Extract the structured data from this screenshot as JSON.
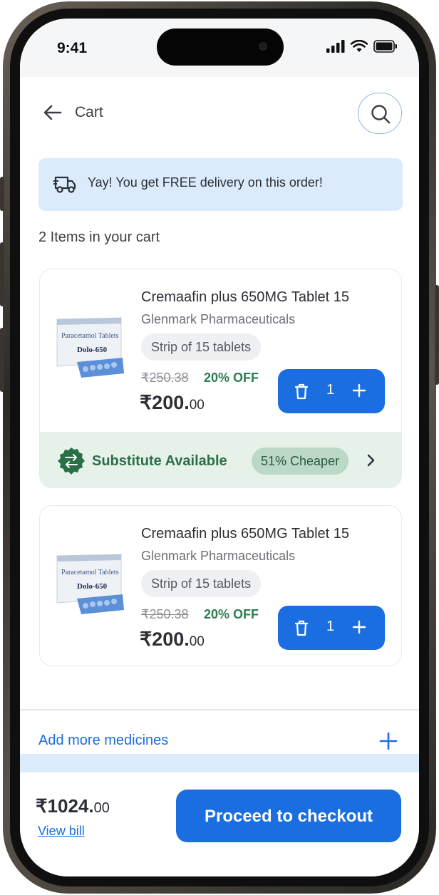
{
  "status_bar": {
    "time": "9:41"
  },
  "header": {
    "title": "Cart"
  },
  "delivery_banner": {
    "text": "Yay! You get FREE delivery on this order!"
  },
  "cart": {
    "count_label": "2 Items in your cart",
    "items": [
      {
        "name": "Cremaafin plus 650MG Tablet 15",
        "brand": "Glenmark Pharmaceuticals",
        "pack": "Strip of 15 tablets",
        "mrp": "₹250.38",
        "discount": "20% OFF",
        "price_main": "₹200.",
        "price_paise": "00",
        "quantity": "1",
        "image_label_top": "Paracetamol Tablets",
        "image_label_brand": "Dolo-650"
      },
      {
        "name": "Cremaafin plus 650MG Tablet 15",
        "brand": "Glenmark Pharmaceuticals",
        "pack": "Strip of 15 tablets",
        "mrp": "₹250.38",
        "discount": "20% OFF",
        "price_main": "₹200.",
        "price_paise": "00",
        "quantity": "1",
        "image_label_top": "Paracetamol Tablets",
        "image_label_brand": "Dolo-650"
      }
    ],
    "substitute": {
      "label": "Substitute Available",
      "badge": "51% Cheaper"
    }
  },
  "add_more": {
    "label": "Add more medicines"
  },
  "footer": {
    "total_main": "₹1024.",
    "total_paise": "00",
    "view_bill": "View bill",
    "checkout_label": "Proceed to checkout"
  },
  "colors": {
    "primary": "#1a6ee0",
    "success": "#2e7d4f",
    "banner_bg": "#dcebfc",
    "substitute_bg": "#e6f1ea"
  },
  "icons": [
    "back-arrow-icon",
    "search-icon",
    "delivery-truck-icon",
    "delete-icon",
    "plus-icon",
    "swap-icon",
    "chevron-right-icon",
    "signal-icon",
    "wifi-icon",
    "battery-icon"
  ]
}
